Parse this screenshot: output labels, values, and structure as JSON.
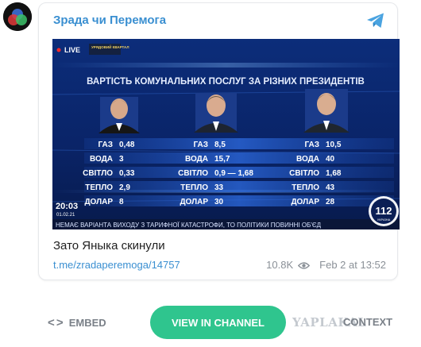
{
  "channel": {
    "name": "Зрада чи Перемога"
  },
  "broadcast": {
    "live_label": "LIVE",
    "show_tag": "УРЯДОВИЙ КВАРТАЛ",
    "title": "ВАРТІСТЬ КОМУНАЛЬНИХ ПОСЛУГ ЗА РІЗНИХ ПРЕЗИДЕНТІВ",
    "columns": [
      {
        "rows": [
          {
            "label": "ГАЗ",
            "value": "0,48"
          },
          {
            "label": "ВОДА",
            "value": "3"
          },
          {
            "label": "СВІТЛО",
            "value": "0,33"
          },
          {
            "label": "ТЕПЛО",
            "value": "2,9"
          },
          {
            "label": "ДОЛАР",
            "value": "8"
          }
        ]
      },
      {
        "rows": [
          {
            "label": "ГАЗ",
            "value": "8,5"
          },
          {
            "label": "ВОДА",
            "value": "15,7"
          },
          {
            "label": "СВІТЛО",
            "value": "0,9 — 1,68"
          },
          {
            "label": "ТЕПЛО",
            "value": "33"
          },
          {
            "label": "ДОЛАР",
            "value": "30"
          }
        ]
      },
      {
        "rows": [
          {
            "label": "ГАЗ",
            "value": "10,5"
          },
          {
            "label": "ВОДА",
            "value": "40"
          },
          {
            "label": "СВІТЛО",
            "value": "1,68"
          },
          {
            "label": "ТЕПЛО",
            "value": "43"
          },
          {
            "label": "ДОЛАР",
            "value": "28"
          }
        ]
      }
    ],
    "time": "20:03",
    "date": "01.02.21",
    "ticker": "НЕМАЄ ВАРІАНТА ВИХОДУ З ТАРИФНОЇ КАТАСТРОФИ, ТО ПОЛІТИКИ ПОВИННІ ОБ'ЄД",
    "channel_logo": "112",
    "channel_logo_sub": "УКРАЇНА"
  },
  "post": {
    "caption": "Зато Яныка скинули",
    "link": "t.me/zradaperemoga/14757",
    "views": "10.8K",
    "date": "Feb 2 at 13:52"
  },
  "actions": {
    "embed_label": "EMBED",
    "embed_icon": "< >",
    "view_label": "VIEW IN CHANNEL",
    "context_label": "CONTEXT"
  },
  "watermark": "YAPLAKAL",
  "colors": {
    "accent": "#3a8fd1",
    "button": "#2fc58e",
    "muted": "#8a9097"
  }
}
